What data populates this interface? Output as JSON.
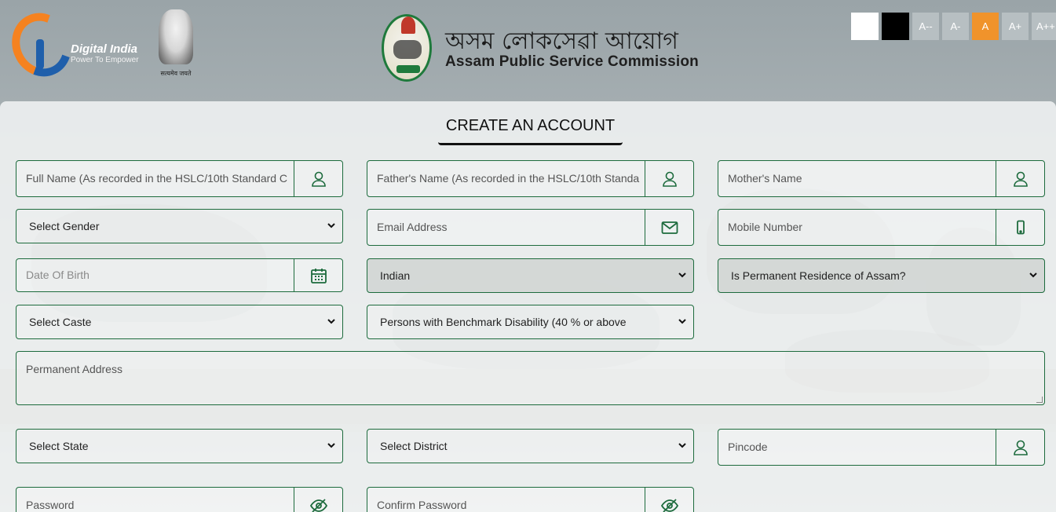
{
  "header": {
    "digital_india_title": "Digital India",
    "digital_india_tagline": "Power To Empower",
    "emblem_motto": "सत्यमेव जयते",
    "org_name_assamese": "অসম লোকসেৱা আয়োগ",
    "org_name_english": "Assam Public Service Commission"
  },
  "accessibility": {
    "font_buttons": [
      {
        "label": "A--",
        "active": false
      },
      {
        "label": "A-",
        "active": false
      },
      {
        "label": "A",
        "active": true
      },
      {
        "label": "A+",
        "active": false
      },
      {
        "label": "A++",
        "active": false
      }
    ],
    "accent_color": "#f0932b"
  },
  "form": {
    "title": "CREATE AN ACCOUNT",
    "full_name_placeholder": "Full Name (As recorded in the HSLC/10th Standard C",
    "father_name_placeholder": "Father's Name (As recorded in the HSLC/10th Standa",
    "mother_name_placeholder": "Mother's Name",
    "gender_select": "Select Gender",
    "email_placeholder": "Email Address",
    "mobile_placeholder": "Mobile Number",
    "dob_placeholder": "Date Of Birth",
    "nationality_select": "Indian",
    "residence_select": "Is Permanent Residence of Assam?",
    "caste_select": "Select Caste",
    "disability_select": "Persons with Benchmark Disability (40 % or above",
    "address_placeholder": "Permanent Address",
    "state_select": "Select State",
    "district_select": "Select District",
    "pincode_placeholder": "Pincode",
    "password_placeholder": "Password",
    "confirm_password_placeholder": "Confirm Password",
    "border_color": "#1d6b3d"
  }
}
